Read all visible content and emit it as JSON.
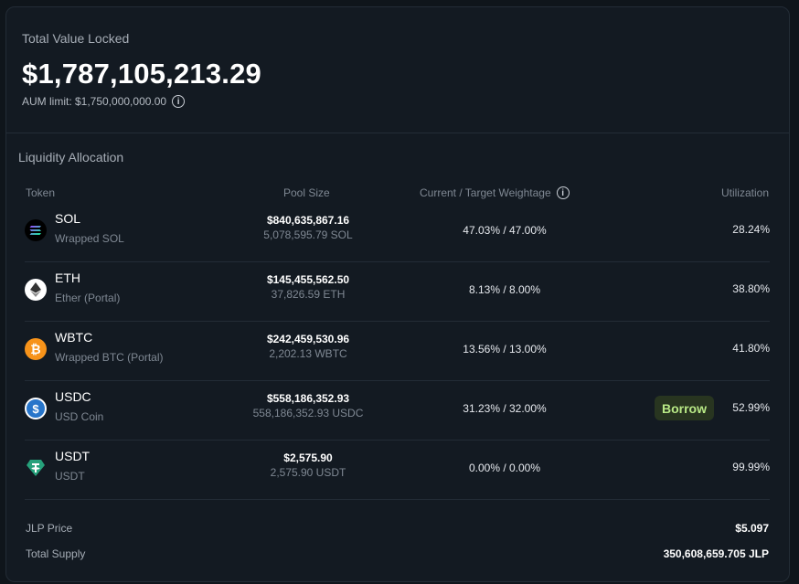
{
  "tvl": {
    "label": "Total Value Locked",
    "value": "$1,787,105,213.29",
    "aum_limit": "AUM limit: $1,750,000,000.00"
  },
  "allocation": {
    "title": "Liquidity Allocation",
    "headers": {
      "token": "Token",
      "pool_size": "Pool Size",
      "weightage": "Current / Target Weightage",
      "utilization": "Utilization"
    },
    "rows": [
      {
        "symbol": "SOL",
        "name": "Wrapped SOL",
        "pool_usd": "$840,635,867.16",
        "pool_amount": "5,078,595.79 SOL",
        "weightage": "47.03% / 47.00%",
        "utilization": "28.24%",
        "icon": "sol-icon"
      },
      {
        "symbol": "ETH",
        "name": "Ether (Portal)",
        "pool_usd": "$145,455,562.50",
        "pool_amount": "37,826.59 ETH",
        "weightage": "8.13% / 8.00%",
        "utilization": "38.80%",
        "icon": "eth-icon"
      },
      {
        "symbol": "WBTC",
        "name": "Wrapped BTC (Portal)",
        "pool_usd": "$242,459,530.96",
        "pool_amount": "2,202.13 WBTC",
        "weightage": "13.56% / 13.00%",
        "utilization": "41.80%",
        "icon": "btc-icon"
      },
      {
        "symbol": "USDC",
        "name": "USD Coin",
        "pool_usd": "$558,186,352.93",
        "pool_amount": "558,186,352.93 USDC",
        "weightage": "31.23% / 32.00%",
        "utilization": "52.99%",
        "icon": "usdc-icon",
        "action": "Borrow"
      },
      {
        "symbol": "USDT",
        "name": "USDT",
        "pool_usd": "$2,575.90",
        "pool_amount": "2,575.90 USDT",
        "weightage": "0.00% / 0.00%",
        "utilization": "99.99%",
        "icon": "usdt-icon"
      }
    ]
  },
  "footer": {
    "jlp_price_label": "JLP Price",
    "jlp_price": "$5.097",
    "total_supply_label": "Total Supply",
    "total_supply": "350,608,659.705 JLP"
  },
  "colors": {
    "background": "#0f151b",
    "card": "#131a22",
    "borrow_bg": "#283520",
    "borrow_text": "#b8e986"
  }
}
